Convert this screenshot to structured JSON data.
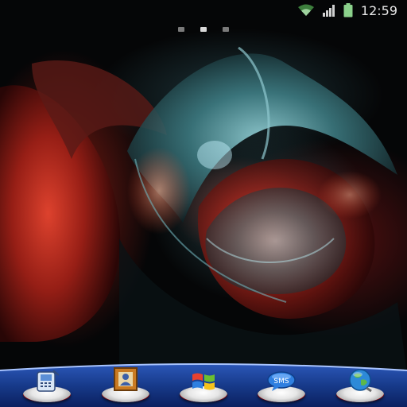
{
  "status_bar": {
    "time": "12:59",
    "icons": [
      "wifi-icon",
      "signal-icon",
      "battery-icon"
    ]
  },
  "home_pages": {
    "count": 3,
    "active_index": 1
  },
  "dock": {
    "items": [
      {
        "name": "phone",
        "icon": "phone-icon"
      },
      {
        "name": "contacts",
        "icon": "contacts-icon"
      },
      {
        "name": "windows",
        "icon": "windows-logo-icon"
      },
      {
        "name": "sms",
        "icon": "sms-icon",
        "label": "SMS"
      },
      {
        "name": "browser",
        "icon": "globe-icon"
      }
    ]
  },
  "colors": {
    "dock_blue": "#173a8a",
    "pedestal_red": "#b00000",
    "status_text": "#e8e8e8",
    "wifi_green": "#3d7f3d"
  }
}
